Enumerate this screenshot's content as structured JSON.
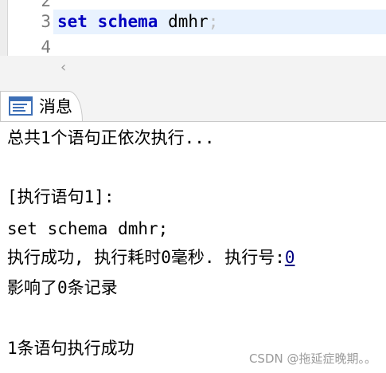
{
  "editor": {
    "line_numbers": [
      "2",
      "3",
      "4"
    ],
    "code": {
      "keyword1": "set",
      "keyword2": "schema",
      "identifier": "dmhr",
      "terminator": ";"
    },
    "scroll_left_glyph": "‹"
  },
  "tab": {
    "icon": "message-list-icon",
    "label": "消息"
  },
  "messages": {
    "line1": "总共1个语句正依次执行...",
    "line2": "[执行语句1]:",
    "line3": "set schema dmhr;",
    "line4_prefix": "执行成功, 执行耗时0毫秒. 执行号:",
    "line4_exec_id": "0",
    "line5": "影响了0条记录",
    "line6": "1条语句执行成功"
  },
  "watermark": "CSDN @拖延症晚期。。",
  "colors": {
    "keyword": "#0000c0",
    "current_line": "#e8f2fe",
    "link": "#000080"
  }
}
